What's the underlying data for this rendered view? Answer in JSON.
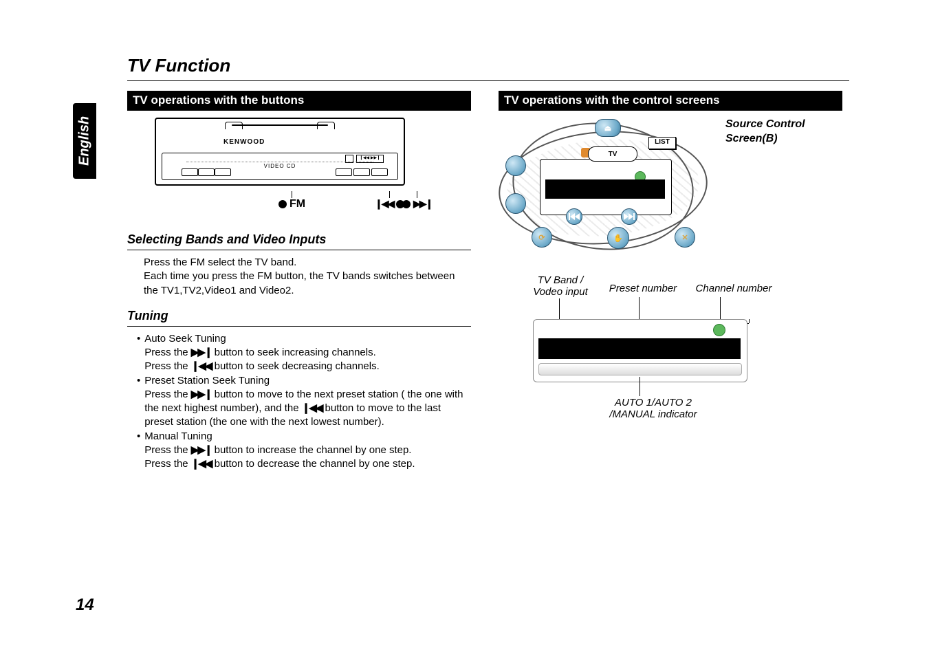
{
  "page": {
    "section_title": "TV Function",
    "side_tab": "English",
    "page_number": "14"
  },
  "left": {
    "header": "TV operations with the buttons",
    "device": {
      "brand": "KENWOOD",
      "panel_label": "VIDEO CD",
      "btn_strip": "❙◀◀ ▶▶❙"
    },
    "callouts": {
      "fm": "FM",
      "prev_glyph": "❙◀◀",
      "next_glyph": "▶▶❙"
    },
    "sub1": {
      "title": "Selecting Bands and Video Inputs",
      "line1": "Press the FM select the TV  band.",
      "line2": "Each time you press the FM button, the TV  bands switches between the TV1,TV2,Video1 and Video2."
    },
    "sub2": {
      "title": "Tuning",
      "auto_seek_title": "Auto Seek Tuning",
      "auto_seek_l1a": "Press the ",
      "auto_seek_l1b": " button to seek increasing channels.",
      "auto_seek_l2a": "Press the ",
      "auto_seek_l2b": " button to seek decreasing channels.",
      "preset_title": "Preset Station Seek Tuning",
      "preset_l1a": "Press the ",
      "preset_l1b": " button to move to the next preset station ( the one with the next highest number), and the ",
      "preset_l1c": " button to move to the last preset station (the one with the next lowest number).",
      "manual_title": "Manual Tuning",
      "manual_l1a": "Press the ",
      "manual_l1b": " button to increase the channel by one step.",
      "manual_l2a": "Press the ",
      "manual_l2b": " button to decrease the channel by one step."
    },
    "glyphs": {
      "next": "▶▶❙",
      "prev": "❙◀◀"
    }
  },
  "right": {
    "header": "TV operations with the control screens",
    "caption1": "Source Control",
    "caption2": "Screen(B)",
    "screen": {
      "list_btn": "LIST",
      "tv_chip": "TV"
    },
    "anno": {
      "band": "TV Band /\nVodeo input",
      "preset": "Preset number",
      "channel": "Channel number",
      "mode": "AUTO 1/AUTO 2\n/MANUAL indicator"
    }
  }
}
